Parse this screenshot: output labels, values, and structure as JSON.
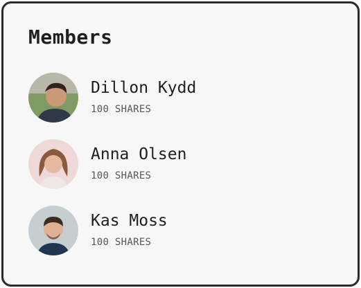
{
  "card": {
    "title": "Members"
  },
  "members": [
    {
      "name": "Dillon Kydd",
      "shares": "100 SHARES"
    },
    {
      "name": "Anna Olsen",
      "shares": "100 SHARES"
    },
    {
      "name": "Kas Moss",
      "shares": "100 SHARES"
    }
  ],
  "colors": {
    "border": "#2a2a2a",
    "background": "#f7f7f8",
    "title": "#1f1f1f",
    "subtext": "#555555"
  }
}
